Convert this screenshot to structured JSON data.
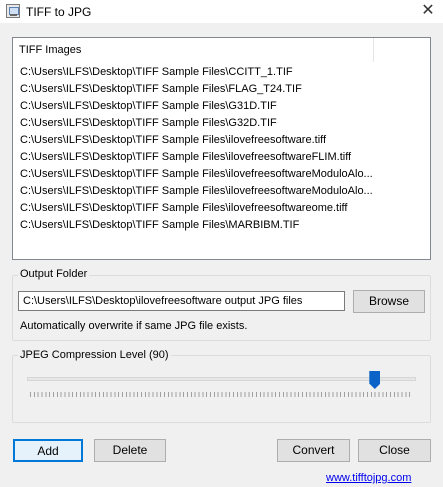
{
  "window": {
    "title": "TIFF to JPG"
  },
  "list": {
    "header": "TIFF Images",
    "items": [
      "C:\\Users\\ILFS\\Desktop\\TIFF Sample Files\\CCITT_1.TIF",
      "C:\\Users\\ILFS\\Desktop\\TIFF Sample Files\\FLAG_T24.TIF",
      "C:\\Users\\ILFS\\Desktop\\TIFF Sample Files\\G31D.TIF",
      "C:\\Users\\ILFS\\Desktop\\TIFF Sample Files\\G32D.TIF",
      "C:\\Users\\ILFS\\Desktop\\TIFF Sample Files\\ilovefreesoftware.tiff",
      "C:\\Users\\ILFS\\Desktop\\TIFF Sample Files\\ilovefreesoftwareFLIM.tiff",
      "C:\\Users\\ILFS\\Desktop\\TIFF Sample Files\\ilovefreesoftwareModuloAlo...",
      "C:\\Users\\ILFS\\Desktop\\TIFF Sample Files\\ilovefreesoftwareModuloAlo...",
      "C:\\Users\\ILFS\\Desktop\\TIFF Sample Files\\ilovefreesoftwareome.tiff",
      "C:\\Users\\ILFS\\Desktop\\TIFF Sample Files\\MARBIBM.TIF"
    ]
  },
  "output": {
    "group_label": "Output Folder",
    "path": "C:\\Users\\ILFS\\Desktop\\ilovefreesoftware output JPG files",
    "browse_label": "Browse",
    "note": "Automatically overwrite if same JPG file exists."
  },
  "compression": {
    "label": "JPEG Compression Level (90)",
    "level": 90,
    "max": 100
  },
  "buttons": {
    "add": "Add",
    "delete": "Delete",
    "convert": "Convert",
    "close": "Close"
  },
  "footer": {
    "link": "www.tifftojpg.com"
  },
  "icons": {
    "app": "image-file-icon",
    "close": "close-icon"
  },
  "colors": {
    "accent": "#0078d7",
    "thumb": "#0b63c8",
    "link": "#0000ee"
  }
}
